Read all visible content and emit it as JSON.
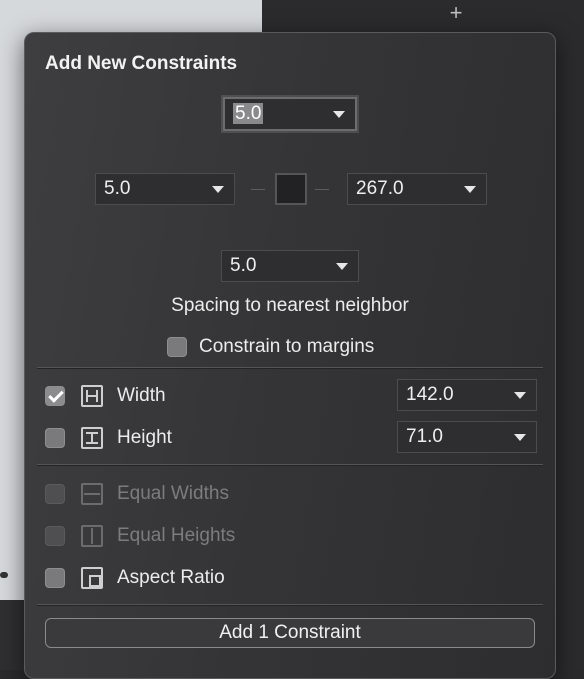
{
  "background": {
    "plus_icon": "plus-icon",
    "plus_glyph": "+"
  },
  "panel": {
    "title": "Add New Constraints",
    "spacing": {
      "top": "5.0",
      "left": "5.0",
      "right": "267.0",
      "bottom": "5.0",
      "label": "Spacing to nearest neighbor"
    },
    "constrain_to_margins": {
      "label": "Constrain to margins",
      "checked": false
    },
    "size": [
      {
        "label": "Width",
        "checked": true,
        "value": "142.0",
        "icon": "width-icon"
      },
      {
        "label": "Height",
        "checked": false,
        "value": "71.0",
        "icon": "height-icon"
      }
    ],
    "relations": [
      {
        "label": "Equal Widths",
        "checked": false,
        "enabled": false,
        "icon": "equal-widths-icon"
      },
      {
        "label": "Equal Heights",
        "checked": false,
        "enabled": false,
        "icon": "equal-heights-icon"
      },
      {
        "label": "Aspect Ratio",
        "checked": false,
        "enabled": true,
        "icon": "aspect-ratio-icon"
      }
    ],
    "add_button_label": "Add 1 Constraint"
  },
  "colors": {
    "panel_background": "#353537",
    "text": "#ececec",
    "disabled_text": "#7c7c7e",
    "checkbox": "#7a7a7c"
  }
}
